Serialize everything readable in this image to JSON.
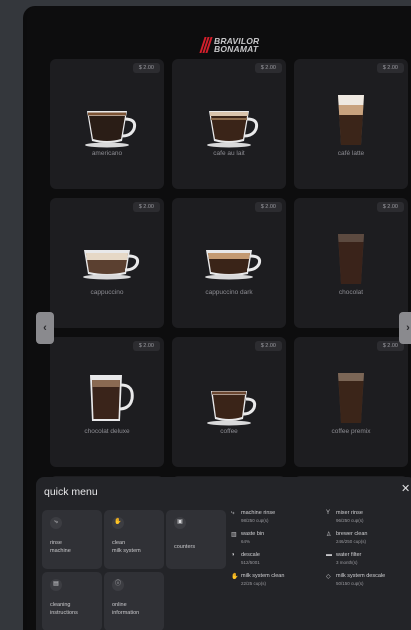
{
  "brand": {
    "line1": "BRAVILOR",
    "line2": "BONAMAT"
  },
  "products": [
    {
      "name": "americano",
      "price": "$ 2.00"
    },
    {
      "name": "cafe au lait",
      "price": "$ 2.00"
    },
    {
      "name": "café latte",
      "price": "$ 2.00"
    },
    {
      "name": "cappuccino",
      "price": "$ 2.00"
    },
    {
      "name": "cappuccino dark",
      "price": "$ 2.00"
    },
    {
      "name": "chocolat",
      "price": "$ 2.00"
    },
    {
      "name": "chocolat deluxe",
      "price": "$ 2.00"
    },
    {
      "name": "coffee",
      "price": "$ 2.00"
    },
    {
      "name": "coffee premix",
      "price": "$ 2.00"
    }
  ],
  "nav": {
    "prev_icon": "‹",
    "next_icon": "›"
  },
  "quick_menu": {
    "title": "quick menu",
    "close_icon": "✕",
    "buttons": [
      {
        "icon": "rinse-icon",
        "glyph": "⤷",
        "label_line1": "rinse",
        "label_line2": "machine"
      },
      {
        "icon": "milk-icon",
        "glyph": "✋",
        "label_line1": "clean",
        "label_line2": "milk system"
      },
      {
        "icon": "counters-icon",
        "glyph": "▣",
        "label_line1": "counters",
        "label_line2": ""
      },
      {
        "icon": "cleaning-icon",
        "glyph": "▤",
        "label_line1": "cleaning",
        "label_line2": "instructions"
      },
      {
        "icon": "info-icon",
        "glyph": "ⓘ",
        "label_line1": "online",
        "label_line2": "information"
      }
    ],
    "status": [
      {
        "icon": "rinse-icon",
        "glyph": "⤷",
        "title": "machine rinse",
        "sub": "98/250 cup(s)"
      },
      {
        "icon": "mixer-icon",
        "glyph": "Y",
        "title": "mixer rinse",
        "sub": "96/250 cup(s)"
      },
      {
        "icon": "bin-icon",
        "glyph": "▥",
        "title": "waste bin",
        "sub": "64%"
      },
      {
        "icon": "brewer-icon",
        "glyph": "♙",
        "title": "brewer clean",
        "sub": "246/250 cup(s)"
      },
      {
        "icon": "descale-icon",
        "glyph": "◑",
        "title": "descale",
        "sub": "512/5001"
      },
      {
        "icon": "filter-icon",
        "glyph": "▬",
        "title": "water filter",
        "sub": "3 month(s)"
      },
      {
        "icon": "milk-icon",
        "glyph": "✋",
        "title": "milk system clean",
        "sub": "22/25 cup(s)"
      },
      {
        "icon": "descale-icon",
        "glyph": "◇",
        "title": "milk system descale",
        "sub": "50/150 cup(s)"
      }
    ]
  }
}
